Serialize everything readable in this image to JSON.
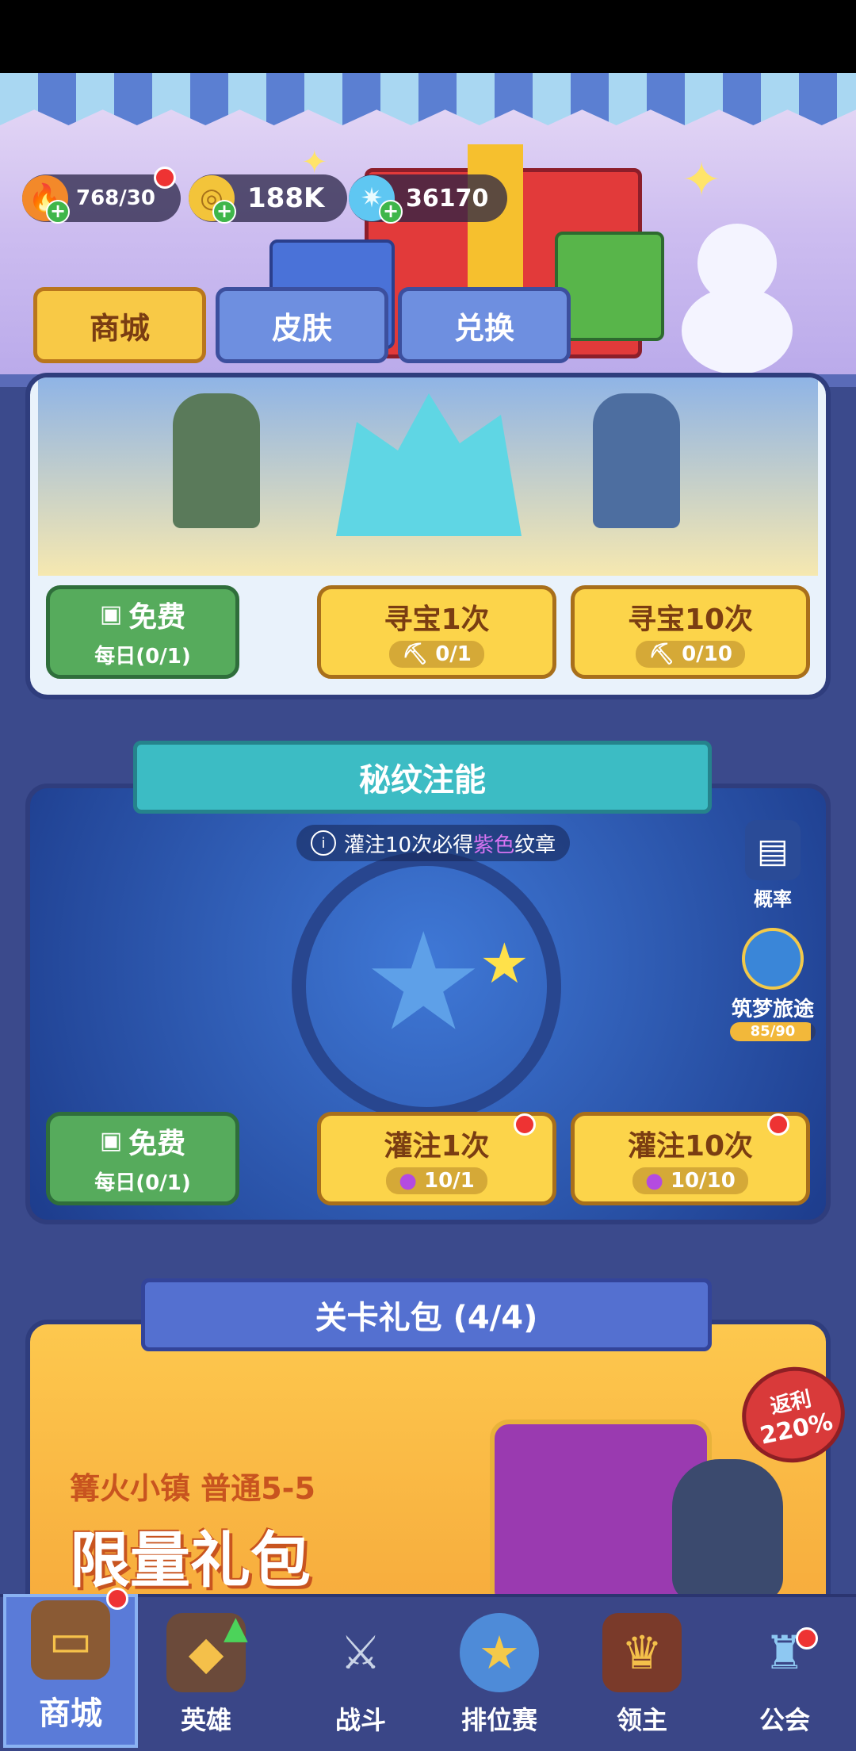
{
  "resources": {
    "stamina": "768/30",
    "gold": "188K",
    "gems": "36170"
  },
  "tabs": [
    {
      "label": "商城"
    },
    {
      "label": "皮肤"
    },
    {
      "label": "兑换"
    }
  ],
  "treasure": {
    "free_label": "免费",
    "free_sub": "每日(0/1)",
    "one_label": "寻宝1次",
    "one_cost": "0/1",
    "ten_label": "寻宝10次",
    "ten_cost": "0/10"
  },
  "infusion": {
    "title": "秘纹注能",
    "notice_pre": "灌注10次必得",
    "notice_highlight": "紫色",
    "notice_post": "纹章",
    "rate_label": "概率",
    "journey_label": "筑梦旅途",
    "journey_progress": "85/90",
    "journey_fraction": 0.944,
    "free_label": "免费",
    "free_sub": "每日(0/1)",
    "one_label": "灌注1次",
    "one_cost": "10/1",
    "ten_label": "灌注10次",
    "ten_cost": "10/10",
    "highlight_color": "#c14fe0"
  },
  "bundle": {
    "title": "关卡礼包 (4/4)",
    "stage": "篝火小镇 普通5-5",
    "name": "限量礼包",
    "rebate_line1": "返利",
    "rebate_line2": "220%"
  },
  "nav": [
    {
      "label": "商城",
      "active": true
    },
    {
      "label": "英雄"
    },
    {
      "label": "战斗"
    },
    {
      "label": "排位赛"
    },
    {
      "label": "领主"
    },
    {
      "label": "公会"
    }
  ],
  "colors": {
    "accent_yellow": "#fcd44a",
    "green": "#56ab5c",
    "nav_bg": "#3a4687"
  }
}
